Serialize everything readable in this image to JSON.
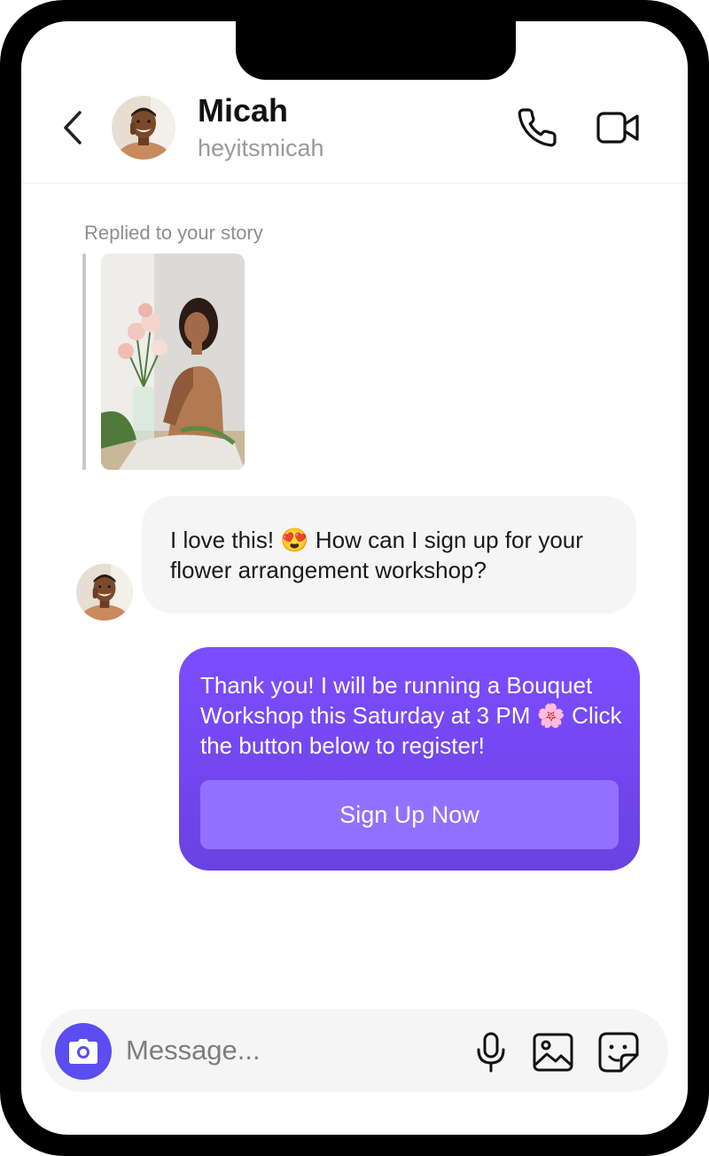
{
  "contact": {
    "name": "Micah",
    "handle": "heyitsmicah"
  },
  "story_reply": {
    "caption": "Replied to your story"
  },
  "messages": [
    {
      "from": "contact",
      "text": "I love this! 😍 How can I sign up for your flower arrangement workshop?"
    },
    {
      "from": "me",
      "text": "Thank you! I will be running a Bouquet Workshop this Saturday at 3 PM 🌸 Click the button below to register!",
      "button_label": "Sign Up Now"
    }
  ],
  "composer": {
    "placeholder": "Message..."
  },
  "colors": {
    "accent": "#5b4df0",
    "outgoing_bubble": "#7c4dff",
    "cta_button": "#9370ff",
    "incoming_bubble": "#f5f5f5"
  },
  "icons": [
    "chevron-left-icon",
    "phone-icon",
    "video-icon",
    "camera-icon",
    "microphone-icon",
    "gallery-icon",
    "sticker-icon"
  ]
}
